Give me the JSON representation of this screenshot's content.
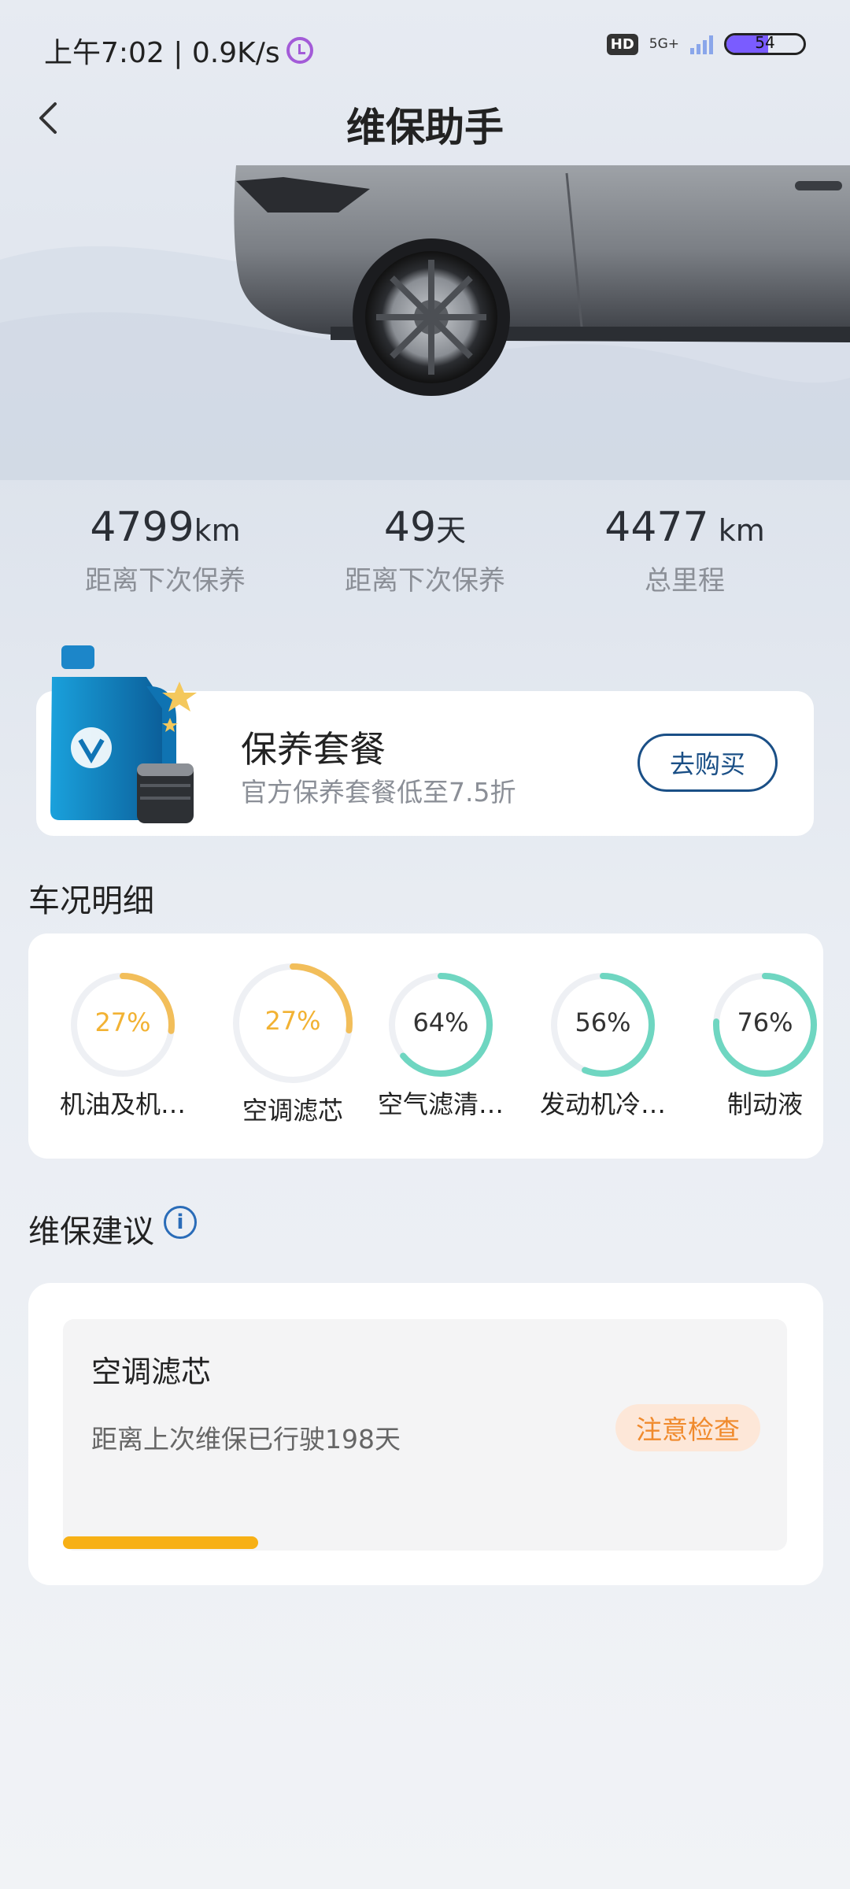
{
  "status_bar": {
    "time_speed": "上午7:02 | 0.9K/s",
    "hd_label": "HD",
    "network_label": "5G+",
    "battery_level": "54"
  },
  "header": {
    "title": "维保助手"
  },
  "stats": [
    {
      "value": "4799",
      "unit": "km",
      "label": "距离下次保养"
    },
    {
      "value": "49",
      "unit": "天",
      "label": "距离下次保养"
    },
    {
      "value": "4477",
      "unit": " km",
      "label": "总里程"
    }
  ],
  "package": {
    "title": "保养套餐",
    "subtitle": "官方保养套餐低至7.5折",
    "button_label": "去购买"
  },
  "condition": {
    "section_title": "车况明细",
    "items": [
      {
        "percent_text": "27%",
        "percent": 27,
        "name": "机油及机…",
        "color": "#f2b233",
        "track": "#eef0f4"
      },
      {
        "percent_text": "27%",
        "percent": 27,
        "name": "空调滤芯",
        "color": "#f2b233",
        "track": "#eef0f4"
      },
      {
        "percent_text": "64%",
        "percent": 64,
        "name": "空气滤清…",
        "color": "#4fcfb4",
        "track": "#eef0f4"
      },
      {
        "percent_text": "56%",
        "percent": 56,
        "name": "发动机冷…",
        "color": "#4fcfb4",
        "track": "#eef0f4"
      },
      {
        "percent_text": "76%",
        "percent": 76,
        "name": "制动液",
        "color": "#4fcfb4",
        "track": "#eef0f4"
      }
    ]
  },
  "advice": {
    "section_title": "维保建议",
    "info_icon": "i",
    "item_title": "空调滤芯",
    "item_desc": "距离上次维保已行驶198天",
    "badge": "注意检查",
    "progress": 0.27,
    "progress_color": "#f7b015"
  }
}
